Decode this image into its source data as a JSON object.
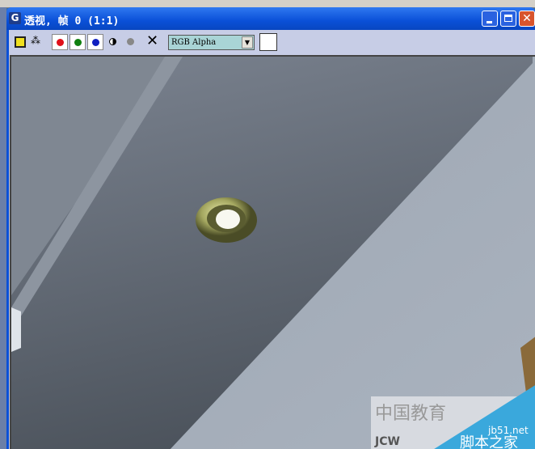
{
  "window": {
    "title": "透视, 帧 0 (1:1)",
    "app_icon": "3dsmax-icon"
  },
  "toolbar": {
    "channel_select": "RGB Alpha",
    "icons": [
      "save-icon",
      "clone-icon",
      "red-channel-icon",
      "green-channel-icon",
      "blue-channel-icon",
      "mono-icon",
      "alpha-icon",
      "clear-icon"
    ]
  },
  "colors": {
    "red": "#e0101a",
    "green": "#108010",
    "blue": "#1020c0",
    "titlebar": "#0a50d8"
  },
  "watermark": {
    "site": "jb51.net",
    "name": "脚本之家",
    "left": "中国教育",
    "logo": "JCW"
  }
}
